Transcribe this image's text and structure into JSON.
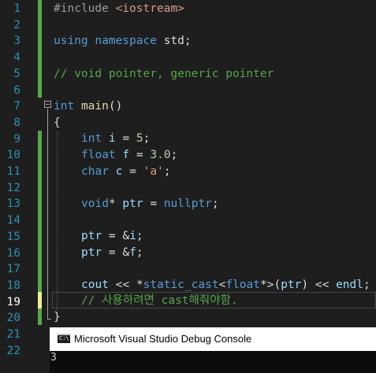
{
  "editor": {
    "line_numbers": [
      "1",
      "2",
      "3",
      "4",
      "5",
      "6",
      "7",
      "8",
      "9",
      "10",
      "11",
      "12",
      "13",
      "14",
      "15",
      "16",
      "17",
      "18",
      "19",
      "20",
      "21",
      "22"
    ],
    "current_line": "19",
    "lines": {
      "l1": {
        "pp": "#include ",
        "inc": "<iostream>"
      },
      "l3": {
        "kw1": "using",
        "kw2": "namespace",
        "rest": " std;"
      },
      "l5": {
        "comment": "// void pointer, generic pointer"
      },
      "l7": {
        "kw": "int",
        "fn": "main",
        "rest": "()"
      },
      "l8": {
        "text": "{"
      },
      "l9": {
        "kw": "int",
        "var": "i",
        "op": " = ",
        "num": "5",
        "end": ";"
      },
      "l10": {
        "kw": "float",
        "var": "f",
        "op": " = ",
        "num": "3.0",
        "end": ";"
      },
      "l11": {
        "kw": "char",
        "var": "c",
        "op": " = ",
        "str": "'a'",
        "end": ";"
      },
      "l13": {
        "kw": "void",
        "star": "* ",
        "var": "ptr",
        "op": " = ",
        "kw2": "nullptr",
        "end": ";"
      },
      "l15": {
        "var": "ptr",
        "op": " = &",
        "var2": "i",
        "end": ";"
      },
      "l16": {
        "var": "ptr",
        "op": " = &",
        "var2": "f",
        "end": ";"
      },
      "l18": {
        "var": "cout",
        "op1": " << *",
        "kw": "static_cast",
        "lt": "<",
        "kw2": "float",
        "mid": "*>(",
        "var2": "ptr",
        "op2": ") << ",
        "var3": "endl",
        "end": ";"
      },
      "l19": {
        "comment": "// 사용하려면 cast해줘야함."
      },
      "l20": {
        "text": "}"
      }
    }
  },
  "console": {
    "icon_label": "C:\\",
    "title": "Microsoft Visual Studio Debug Console",
    "output": "3"
  }
}
